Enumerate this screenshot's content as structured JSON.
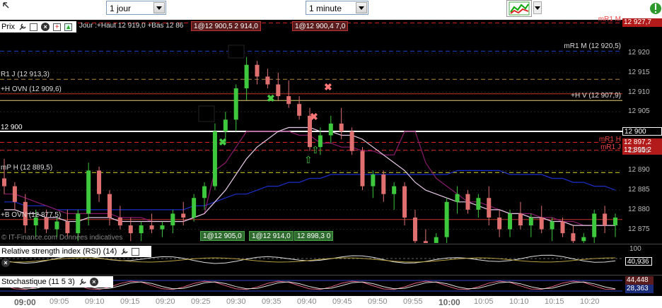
{
  "toolbar": {
    "period_value": "1 jour",
    "interval_value": "1 minute"
  },
  "price_panel": {
    "title": "Prix",
    "info": "Jour :+Haut 12 919,0 +Bas 12 86",
    "quote_tag1": "1@12 900,5 2 914,0",
    "quote_tag2": "1@12 900,4 7,0",
    "bottom_tag1": "1@12 905,0",
    "bottom_tag2": "1@12 914,0",
    "bottom_tag3": "12 898,3 0",
    "watermark": "© IT-Finance.com Données indicatives"
  },
  "chart_data": {
    "type": "candlestick",
    "price_ticks": [
      "12 920",
      "12 915",
      "12 910",
      "12 905",
      "12 900",
      "12 895",
      "12 890",
      "12 885",
      "12 880",
      "12 875"
    ],
    "time_ticks": [
      "09:00",
      "09:05",
      "09:10",
      "09:15",
      "09:20",
      "09:25",
      "09:30",
      "09:35",
      "09:40",
      "09:45",
      "09:50",
      "09:55",
      "10:00",
      "10:05",
      "10:10",
      "10:15",
      "10:20"
    ],
    "levels": [
      {
        "label": "mR1 M (12 920,5)",
        "value": 12920.5,
        "color": "#1a3fcc",
        "right_label": ""
      },
      {
        "label": "R1 J (12 913,3)",
        "value": 12913.3,
        "color": "#b3863a",
        "right_label": ""
      },
      {
        "label": "+H OVN (12 909,6)",
        "value": 12909.6,
        "color": "#c0392b",
        "right_label": ""
      },
      {
        "label": "+H V (12 907,9)",
        "value": 12907.9,
        "color": "#e8d36a",
        "right_label": ""
      },
      {
        "label": "12 900",
        "value": 12900,
        "color": "#ffffff",
        "right_label": "12 900"
      },
      {
        "label": "mR1 H",
        "value": 12897.2,
        "color": "#d22",
        "right_label": "12 897,2"
      },
      {
        "label": "mR1 J",
        "value": 12895.2,
        "color": "#d22",
        "right_label": "12 895,2"
      },
      {
        "label": "mP H (12 889,5)",
        "value": 12889.5,
        "color": "#d8d822",
        "right_label": ""
      },
      {
        "label": "+B OVN (12 877,5)",
        "value": 12877.5,
        "color": "#c0392b",
        "right_label": ""
      },
      {
        "label": "mR1 M",
        "value": 12927.7,
        "color": "#d22",
        "right_label": "12 927,7"
      }
    ],
    "candles": [
      [
        12888,
        12893,
        12884,
        12886
      ],
      [
        12886,
        12887,
        12880,
        12882
      ],
      [
        12882,
        12884,
        12874,
        12876
      ],
      [
        12876,
        12880,
        12873,
        12878
      ],
      [
        12878,
        12880,
        12874,
        12875
      ],
      [
        12875,
        12878,
        12873,
        12877
      ],
      [
        12877,
        12880,
        12873,
        12874
      ],
      [
        12874,
        12880,
        12872,
        12879
      ],
      [
        12879,
        12892,
        12876,
        12890
      ],
      [
        12890,
        12891,
        12882,
        12884
      ],
      [
        12884,
        12885,
        12876,
        12878
      ],
      [
        12878,
        12881,
        12875,
        12876
      ],
      [
        12876,
        12878,
        12872,
        12874
      ],
      [
        12874,
        12877,
        12872,
        12876
      ],
      [
        12876,
        12879,
        12874,
        12875
      ],
      [
        12875,
        12877,
        12873,
        12876
      ],
      [
        12876,
        12880,
        12874,
        12879
      ],
      [
        12879,
        12882,
        12876,
        12878
      ],
      [
        12878,
        12884,
        12877,
        12883
      ],
      [
        12883,
        12887,
        12880,
        12886
      ],
      [
        12886,
        12902,
        12885,
        12900
      ],
      [
        12900,
        12905,
        12897,
        12903
      ],
      [
        12903,
        12912,
        12900,
        12911
      ],
      [
        12911,
        12919,
        12908,
        12917
      ],
      [
        12917,
        12918,
        12912,
        12914
      ],
      [
        12914,
        12916,
        12911,
        12912
      ],
      [
        12912,
        12915,
        12908,
        12909
      ],
      [
        12909,
        12913,
        12906,
        12907
      ],
      [
        12907,
        12909,
        12903,
        12904
      ],
      [
        12904,
        12906,
        12895,
        12896
      ],
      [
        12896,
        12901,
        12894,
        12899
      ],
      [
        12899,
        12904,
        12897,
        12902
      ],
      [
        12902,
        12906,
        12898,
        12900
      ],
      [
        12900,
        12901,
        12894,
        12895
      ],
      [
        12895,
        12896,
        12885,
        12886
      ],
      [
        12886,
        12890,
        12883,
        12889
      ],
      [
        12889,
        12890,
        12882,
        12884
      ],
      [
        12884,
        12887,
        12880,
        12886
      ],
      [
        12886,
        12887,
        12876,
        12878
      ],
      [
        12878,
        12880,
        12870,
        12872
      ],
      [
        12872,
        12875,
        12868,
        12870
      ],
      [
        12870,
        12874,
        12868,
        12873
      ],
      [
        12873,
        12883,
        12871,
        12882
      ],
      [
        12882,
        12886,
        12879,
        12884
      ],
      [
        12884,
        12885,
        12879,
        12880
      ],
      [
        12880,
        12884,
        12878,
        12883
      ],
      [
        12883,
        12886,
        12876,
        12878
      ],
      [
        12878,
        12880,
        12873,
        12875
      ],
      [
        12875,
        12880,
        12873,
        12879
      ],
      [
        12879,
        12882,
        12875,
        12876
      ],
      [
        12876,
        12879,
        12873,
        12878
      ],
      [
        12878,
        12881,
        12874,
        12875
      ],
      [
        12875,
        12878,
        12872,
        12877
      ],
      [
        12877,
        12878,
        12873,
        12874
      ],
      [
        12874,
        12876,
        12870,
        12872
      ],
      [
        12872,
        12874,
        12868,
        12873
      ],
      [
        12873,
        12880,
        12871,
        12879
      ],
      [
        12879,
        12881,
        12874,
        12876
      ],
      [
        12876,
        12879,
        12873,
        12878
      ]
    ],
    "ma_white": [
      12880,
      12880,
      12879,
      12879,
      12878,
      12878,
      12877,
      12877,
      12878,
      12878,
      12878,
      12877,
      12877,
      12877,
      12877,
      12877,
      12877,
      12877,
      12878,
      12879,
      12882,
      12885,
      12889,
      12893,
      12896,
      12898,
      12900,
      12901,
      12901,
      12901,
      12900,
      12900,
      12899,
      12899,
      12898,
      12896,
      12894,
      12892,
      12890,
      12887,
      12885,
      12884,
      12883,
      12882,
      12882,
      12881,
      12880,
      12880,
      12879,
      12879,
      12878,
      12878,
      12877,
      12877,
      12876,
      12876,
      12876,
      12876,
      12876
    ],
    "ma_blue": [
      12882,
      12882,
      12881,
      12881,
      12881,
      12880,
      12880,
      12880,
      12880,
      12880,
      12880,
      12880,
      12880,
      12880,
      12880,
      12880,
      12880,
      12880,
      12881,
      12881,
      12882,
      12883,
      12884,
      12884,
      12885,
      12886,
      12886,
      12887,
      12887,
      12888,
      12888,
      12889,
      12889,
      12889,
      12889,
      12889,
      12889,
      12889,
      12889,
      12889,
      12889,
      12889,
      12889,
      12890,
      12890,
      12890,
      12890,
      12890,
      12889,
      12889,
      12889,
      12889,
      12888,
      12888,
      12887,
      12887,
      12886,
      12886,
      12885
    ],
    "ma_purple": [
      12884,
      12884,
      12883,
      12882,
      12881,
      12880,
      12879,
      12879,
      12879,
      12879,
      12879,
      12878,
      12878,
      12878,
      12877,
      12877,
      12877,
      12877,
      12878,
      12879,
      12890,
      12892,
      12896,
      12900,
      12900,
      12900,
      12900,
      12900,
      12899,
      12899,
      12897,
      12897,
      12896,
      12896,
      12895,
      12895,
      12894,
      12894,
      12900,
      12900,
      12892,
      12888,
      12886,
      12884,
      12882,
      12882,
      12881,
      12880,
      12879,
      12879,
      12879,
      12878,
      12878,
      12877,
      12877,
      12876,
      12876,
      12876,
      12876
    ]
  },
  "rsi_panel": {
    "title": "Relative strength index (RSI) (14)",
    "upper": "100",
    "value": "40,936"
  },
  "stoch_panel": {
    "title": "Stochastique (11 5 3)",
    "value1": "44,448",
    "value2": "28,363"
  }
}
